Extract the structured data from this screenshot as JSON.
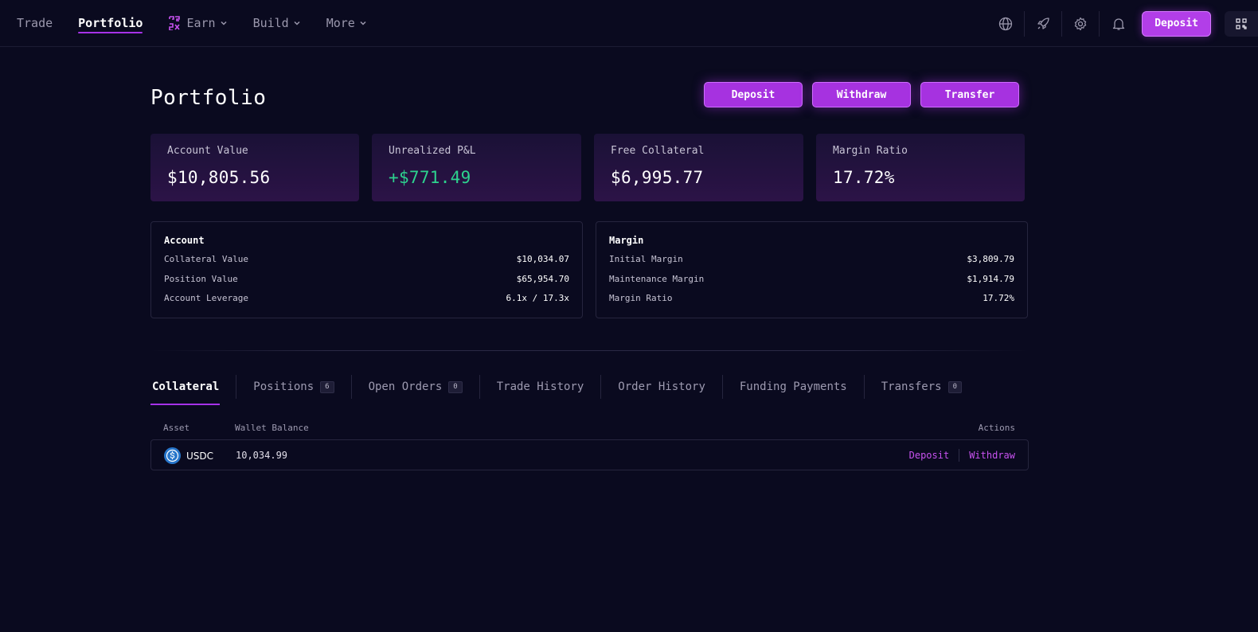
{
  "nav": {
    "items": [
      {
        "label": "Trade",
        "active": false,
        "dropdown": false
      },
      {
        "label": "Portfolio",
        "active": true,
        "dropdown": false
      },
      {
        "label": "Earn",
        "active": false,
        "dropdown": true
      },
      {
        "label": "Build",
        "active": false,
        "dropdown": true
      },
      {
        "label": "More",
        "active": false,
        "dropdown": true
      }
    ],
    "deposit_label": "Deposit",
    "icons": [
      "globe-icon",
      "rocket-icon",
      "gear-icon",
      "bell-icon",
      "qr-icon"
    ]
  },
  "page": {
    "title": "Portfolio",
    "buttons": {
      "deposit": "Deposit",
      "withdraw": "Withdraw",
      "transfer": "Transfer"
    }
  },
  "stats": [
    {
      "label": "Account Value",
      "value": "$10,805.56"
    },
    {
      "label": "Unrealized P&L",
      "value": "+$771.49"
    },
    {
      "label": "Free Collateral",
      "value": "$6,995.77"
    },
    {
      "label": "Margin Ratio",
      "value": "17.72%"
    }
  ],
  "account": {
    "title": "Account",
    "rows": [
      {
        "label": "Collateral Value",
        "value": "$10,034.07"
      },
      {
        "label": "Position Value",
        "value": "$65,954.70"
      },
      {
        "label": "Account Leverage",
        "value": "6.1x / 17.3x"
      }
    ]
  },
  "margin": {
    "title": "Margin",
    "rows": [
      {
        "label": "Initial Margin",
        "value": "$3,809.79"
      },
      {
        "label": "Maintenance Margin",
        "value": "$1,914.79"
      },
      {
        "label": "Margin Ratio",
        "value": "17.72%"
      }
    ]
  },
  "tabs": [
    {
      "label": "Collateral",
      "count": null,
      "active": true
    },
    {
      "label": "Positions",
      "count": "6",
      "active": false
    },
    {
      "label": "Open Orders",
      "count": "0",
      "active": false
    },
    {
      "label": "Trade History",
      "count": null,
      "active": false
    },
    {
      "label": "Order History",
      "count": null,
      "active": false
    },
    {
      "label": "Funding Payments",
      "count": null,
      "active": false
    },
    {
      "label": "Transfers",
      "count": "0",
      "active": false
    }
  ],
  "table": {
    "headers": {
      "asset": "Asset",
      "balance": "Wallet Balance",
      "actions": "Actions"
    },
    "rows": [
      {
        "asset": "USDC",
        "balance": "10,034.99",
        "deposit": "Deposit",
        "withdraw": "Withdraw"
      }
    ]
  },
  "colors": {
    "accent": "#a632e8",
    "positive": "#2dd28e",
    "background": "#0a0a1f"
  }
}
